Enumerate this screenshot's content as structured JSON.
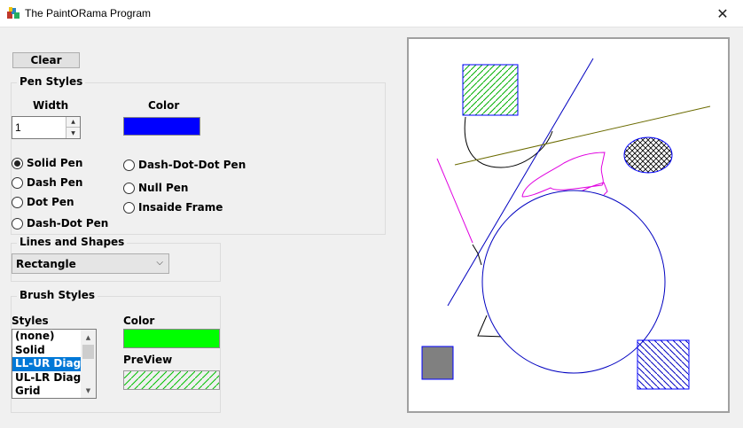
{
  "window": {
    "title": "The PaintORama Program",
    "close_glyph": "✕",
    "icon": "paint-app-icon"
  },
  "controls": {
    "clear_label": "Clear"
  },
  "pen_styles": {
    "group_title": "Pen Styles",
    "width_label": "Width",
    "width_value": "1",
    "color_label": "Color",
    "color": "#0000ff",
    "options": [
      {
        "label": "Solid Pen",
        "checked": true
      },
      {
        "label": "Dash Pen",
        "checked": false
      },
      {
        "label": "Dot Pen",
        "checked": false
      },
      {
        "label": "Dash-Dot Pen",
        "checked": false
      },
      {
        "label": "Dash-Dot-Dot Pen",
        "checked": false
      },
      {
        "label": "Null Pen",
        "checked": false
      },
      {
        "label": "Insaide Frame",
        "checked": false
      }
    ]
  },
  "lines_shapes": {
    "group_title": "Lines and Shapes",
    "selected": "Rectangle"
  },
  "brush_styles": {
    "group_title": "Brush Styles",
    "styles_label": "Styles",
    "color_label": "Color",
    "color": "#00ff00",
    "preview_label": "PreView",
    "items": [
      "(none)",
      "Solid",
      "LL-UR Diag",
      "UL-LR Diag",
      "Grid"
    ],
    "selected_index": 2
  }
}
